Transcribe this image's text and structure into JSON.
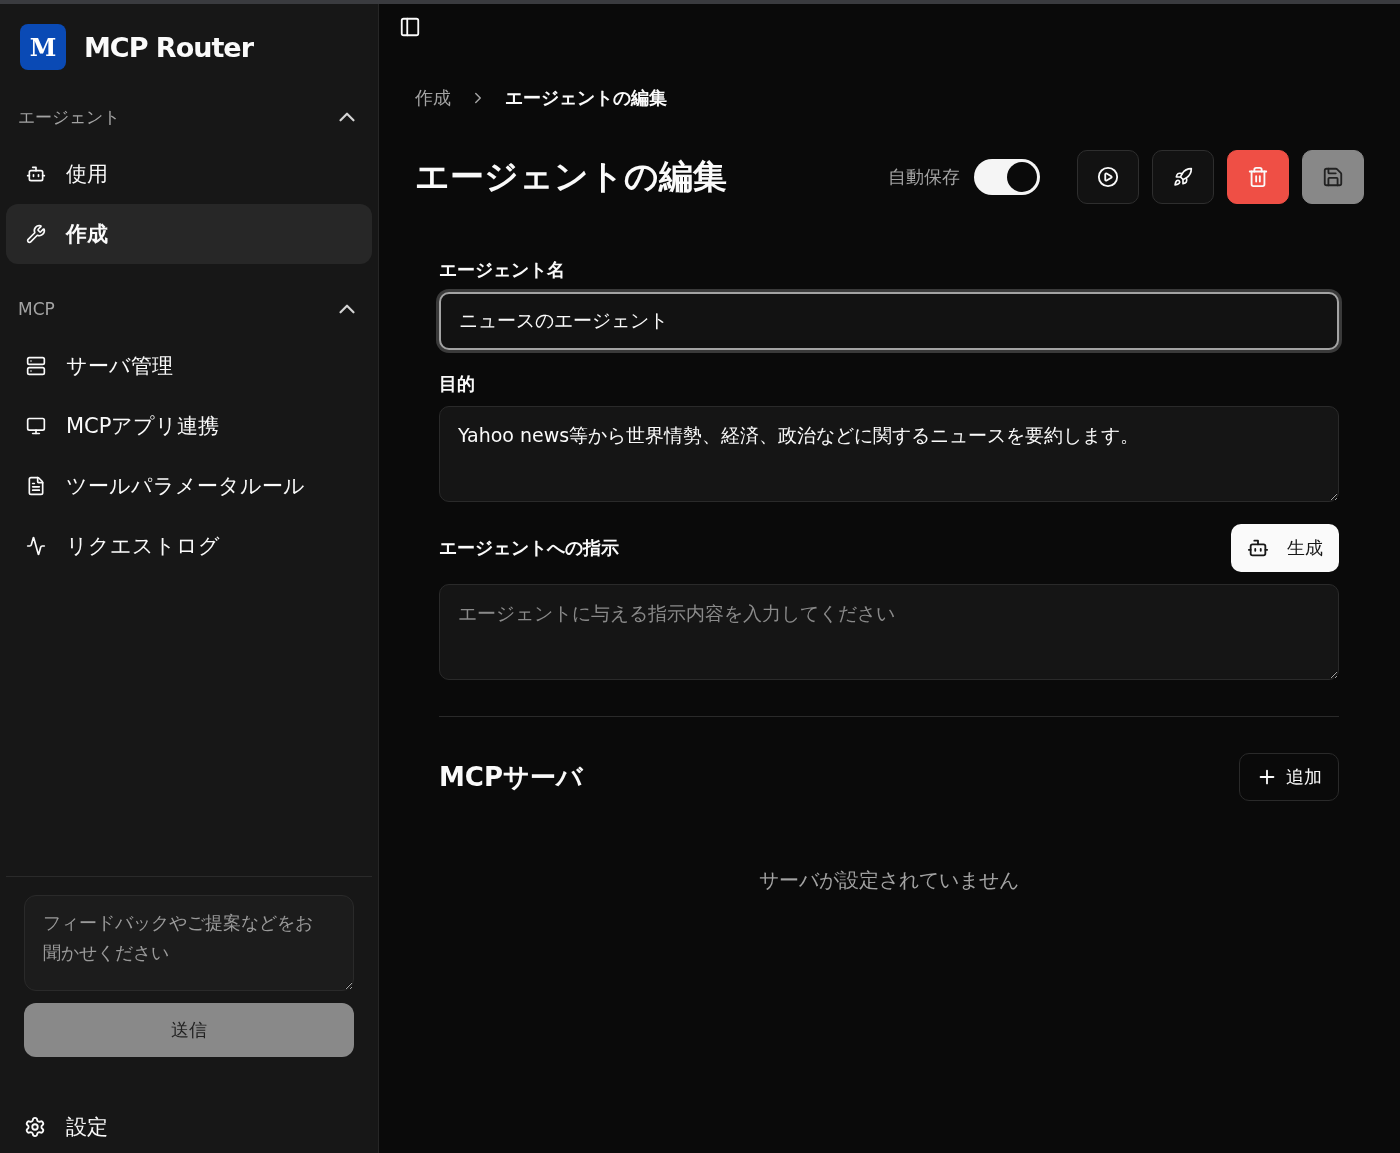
{
  "app": {
    "logo_letter": "M",
    "title": "MCP Router"
  },
  "sidebar": {
    "sections": [
      {
        "title": "エージェント",
        "expanded": true,
        "items": [
          {
            "label": "使用",
            "selected": false
          },
          {
            "label": "作成",
            "selected": true
          }
        ]
      },
      {
        "title": "MCP",
        "expanded": true,
        "items": [
          {
            "label": "サーバ管理",
            "selected": false
          },
          {
            "label": "MCPアプリ連携",
            "selected": false
          },
          {
            "label": "ツールパラメータルール",
            "selected": false
          },
          {
            "label": "リクエストログ",
            "selected": false
          }
        ]
      }
    ],
    "feedback": {
      "placeholder": "フィードバックやご提案などをお聞かせください",
      "submit": "送信"
    },
    "settings": "設定"
  },
  "breadcrumb": [
    "作成",
    "エージェントの編集"
  ],
  "page": {
    "title": "エージェントの編集",
    "autosave": {
      "label": "自動保存",
      "on": true
    }
  },
  "form": {
    "name": {
      "label": "エージェント名",
      "value": "ニュースのエージェント"
    },
    "purpose": {
      "label": "目的",
      "value": "Yahoo news等から世界情勢、経済、政治などに関するニュースを要約します。"
    },
    "instructions": {
      "label": "エージェントへの指示",
      "generate": "生成",
      "placeholder": "エージェントに与える指示内容を入力してください"
    }
  },
  "mcp_servers": {
    "title": "MCPサーバ",
    "add": "追加",
    "empty": "サーバが設定されていません"
  }
}
